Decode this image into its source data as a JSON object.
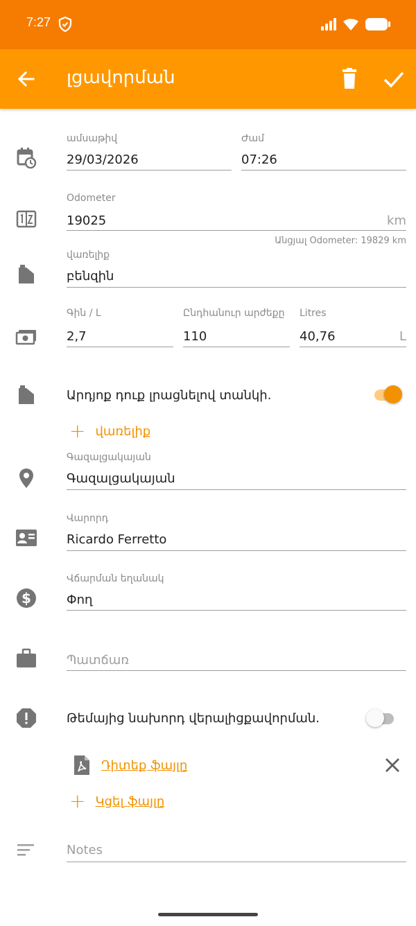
{
  "status_bar": {
    "time": "7:27"
  },
  "app_bar": {
    "title": "լցավորման",
    "icons": [
      "arrow-left-icon",
      "trash-icon",
      "check-icon"
    ]
  },
  "form": {
    "date": {
      "label": "ամսաթիվ",
      "value": "29/03/2026"
    },
    "time": {
      "label": "Ժամ",
      "value": "07:26"
    },
    "odometer": {
      "label": "Odometer",
      "value": "19025",
      "unit": "km",
      "helper": "Անցյալ Odometer: 19829 km"
    },
    "fuel": {
      "label": "վառելիք",
      "value": "բենզին"
    },
    "price": {
      "label": "Գին / L",
      "value": "2,7"
    },
    "total": {
      "label": "Ընդհանուր արժեքը",
      "value": "110"
    },
    "litres": {
      "label": "Litres",
      "value": "40,76",
      "unit": "L"
    },
    "full_tank": {
      "label": "Արդյոք դուք լրացնելով տանկի.",
      "on": true
    },
    "add_fuel": {
      "label": "վառելիք"
    },
    "station": {
      "label": "Գազալցակայան",
      "value": "Գազալցակայան"
    },
    "driver": {
      "label": "Վարորդ",
      "value": "Ricardo Ferretto"
    },
    "payment": {
      "label": "Վճարման եղանակ",
      "value": "Փող"
    },
    "reason": {
      "placeholder": "Պատճառ"
    },
    "missed_previous": {
      "label": "Թեմայից նախորդ վերալիցքավորման.",
      "on": false
    },
    "attachment": {
      "label": "Դիտեք ֆայլը"
    },
    "attach_file": {
      "label": "Կցել ֆայլը"
    },
    "notes": {
      "placeholder": "Notes"
    }
  },
  "colors": {
    "status_bar": "#f57c00",
    "app_bar": "#ff9800",
    "accent": "#f39200",
    "icon_gray": "#757575"
  }
}
